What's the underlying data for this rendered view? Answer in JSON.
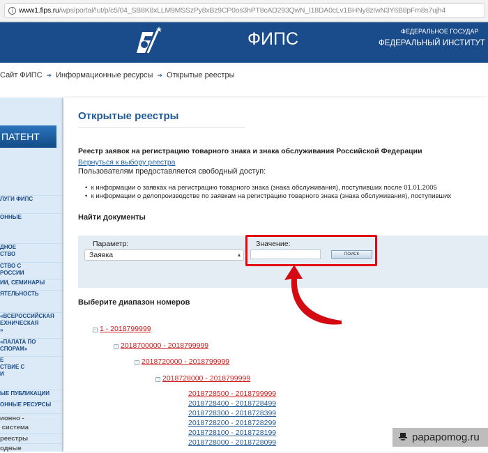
{
  "browser": {
    "url_host": "www1.fips.ru",
    "url_path": "/wps/portal/!ut/p/c5/04_SB8K8xLLM9MSSzPy8xBz9CP0os3hPT8cAD293QwN_I18DA0cLv1BHNy8zIwN3Y6B8pFm8s7ujh4"
  },
  "header": {
    "title": "ФИПС",
    "line1": "ФЕДЕРАЛЬНОЕ ГОСУДАР",
    "line2": "ФЕДЕРАЛЬНЫЙ ИНСТИТУТ"
  },
  "breadcrumb": [
    "Сайт ФИПС",
    "Информационные ресурсы",
    "Открытые реестры"
  ],
  "sidebar": {
    "patent_button": "ПАТЕНТ",
    "items": [
      "ЛУГИ ФИПС",
      "ОННЫЕ",
      "ДНОЕ\nСТВО",
      "СТВО С\nРОССИИ",
      "ИИ, СЕМИНАРЫ",
      "ЯТЕЛЬНОСТЬ",
      "«ВСЕРОССИЙСКАЯ\nЕХНИЧЕСКАЯ\n»",
      "«ПАЛАТА ПО\nСПОРАМ»",
      "Е\nСТВИЕ С\nИ",
      "ЫЕ ПУБЛИКАЦИИ",
      "ОННЫЕ РЕСУРСЫ",
      "ионно -\n система",
      "реестры",
      "одные"
    ]
  },
  "main": {
    "title": "Открытые реестры",
    "registry_title": "Реестр заявок на регистрацию товарного знака и знака обслуживания Российской Федерации",
    "back_link": "Вернуться к выбору реестра",
    "free_access": "Пользователям предоставляется свободный доступ:",
    "bullets": [
      "к информации о заявках на регистрацию товарного знака (знака обслуживания), поступивших после 01.01.2005",
      "к информации о делопроизводстве по заявкам на регистрацию товарного знака (знака обслуживания), поступивших"
    ],
    "find_heading": "Найти документы",
    "search": {
      "param_label": "Параметр:",
      "param_value": "Заявка",
      "value_label": "Значение:",
      "value": "",
      "button": "ПОИСК"
    },
    "range_heading": "Выберите диапазон номеров",
    "tree": [
      {
        "label": "1 - 2018799999",
        "level": 0,
        "expanded": true,
        "active": true
      },
      {
        "label": "2018700000 - 2018799999",
        "level": 1,
        "expanded": true,
        "active": true
      },
      {
        "label": "2018720000 - 2018799999",
        "level": 2,
        "expanded": true,
        "active": true
      },
      {
        "label": "2018728000 - 2018799999",
        "level": 3,
        "expanded": true,
        "active": true
      },
      {
        "label": "2018728500 - 2018799999",
        "level": 4,
        "active": true
      },
      {
        "label": "2018728400 - 2018728499",
        "level": 4,
        "active": false
      },
      {
        "label": "2018728300 - 2018728399",
        "level": 4,
        "active": false
      },
      {
        "label": "2018728200 - 2018728299",
        "level": 4,
        "active": false
      },
      {
        "label": "2018728100 - 2018728199",
        "level": 4,
        "active": false
      },
      {
        "label": "2018728000 - 2018728099",
        "level": 4,
        "active": false
      }
    ]
  },
  "watermark": "papapomog.ru",
  "colors": {
    "header": "#1a4c8b",
    "highlight": "#e40613",
    "link_active": "#d01c1c",
    "link": "#1f5a96"
  }
}
